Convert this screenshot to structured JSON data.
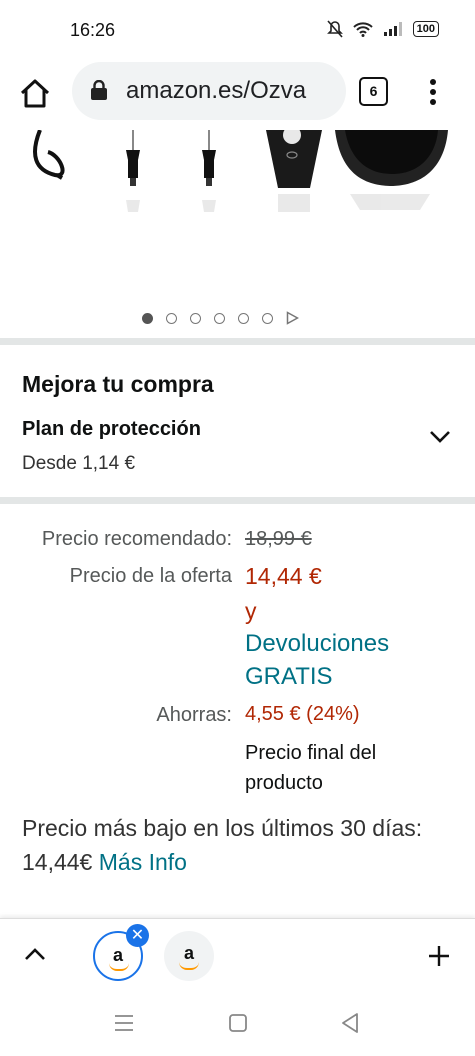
{
  "status": {
    "time": "16:26",
    "battery": "100"
  },
  "browser": {
    "url": "amazon.es/Ozva",
    "tab_count": "6"
  },
  "gallery": {
    "dot_count": 6,
    "active_index": 0
  },
  "upgrade": {
    "title": "Mejora tu compra",
    "plan_label": "Plan de protección",
    "plan_price": "Desde 1,14 €"
  },
  "price": {
    "list_label": "Precio recomendado:",
    "list_value": "18,99 €",
    "deal_label": "Precio de la oferta",
    "deal_value": "14,44 €",
    "deal_connector": "y",
    "returns_line1": "Devoluciones",
    "returns_line2": "GRATIS",
    "savings_label": "Ahorras:",
    "savings_value": "4,55 € (24%)",
    "final_line1": "Precio final del",
    "final_line2": "producto"
  },
  "lowest": {
    "text": "Precio más bajo en los últimos 30 días: 14,44€",
    "link": "Más Info"
  },
  "tabstrip": {
    "favicon_letter": "a"
  },
  "colors": {
    "price_red": "#b12704",
    "link_teal": "#007185",
    "chrome_blue": "#1a73e8"
  }
}
